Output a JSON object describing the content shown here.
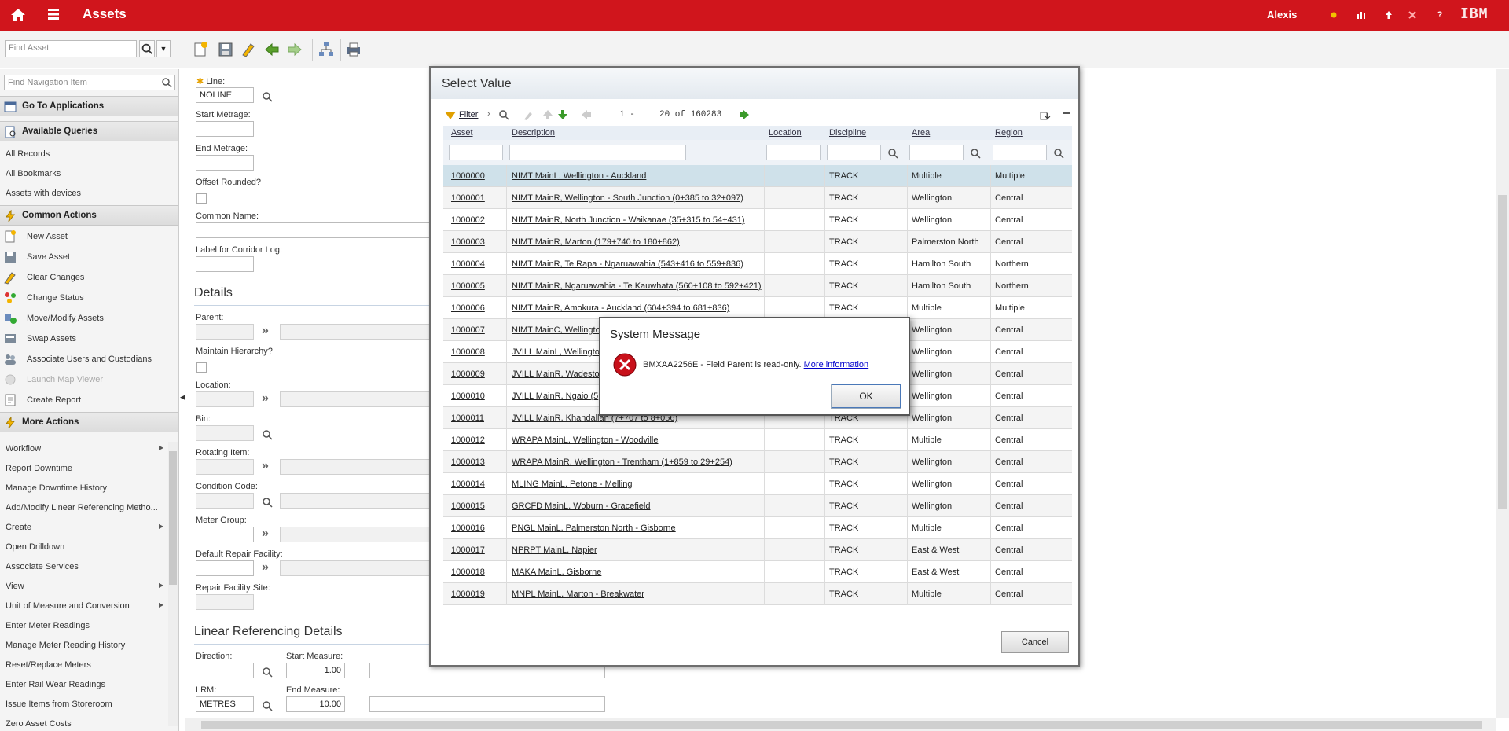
{
  "header": {
    "app_title": "Assets",
    "user": "Alexis",
    "logo": "IBM",
    "icons": [
      "home-icon",
      "menu-icon",
      "bulletin-icon",
      "reports-icon",
      "profile-icon",
      "close-icon",
      "help-icon"
    ]
  },
  "toolbar": {
    "find_placeholder": "Find Asset"
  },
  "nav": {
    "search_placeholder": "Find Navigation Item",
    "go_to_apps": "Go To Applications",
    "available_queries": "Available Queries",
    "queries": [
      "All Records",
      "All Bookmarks",
      "Assets with devices"
    ],
    "common_actions": "Common Actions",
    "actions": [
      {
        "label": "New Asset",
        "icon": "new-asset-icon"
      },
      {
        "label": "Save Asset",
        "icon": "save-icon"
      },
      {
        "label": "Clear Changes",
        "icon": "eraser-icon"
      },
      {
        "label": "Change Status",
        "icon": "change-status-icon"
      },
      {
        "label": "Move/Modify Assets",
        "icon": "move-assets-icon"
      },
      {
        "label": "Swap Assets",
        "icon": "swap-icon"
      },
      {
        "label": "Associate Users and Custodians",
        "icon": "users-icon"
      },
      {
        "label": "Launch Map Viewer",
        "icon": "map-icon",
        "disabled": true
      },
      {
        "label": "Create Report",
        "icon": "report-icon"
      }
    ],
    "more_actions": "More Actions",
    "more": [
      {
        "label": "Workflow",
        "sub": true
      },
      {
        "label": "Report Downtime",
        "sub": false
      },
      {
        "label": "Manage Downtime History",
        "sub": false
      },
      {
        "label": "Add/Modify Linear Referencing Metho...",
        "sub": false
      },
      {
        "label": "Create",
        "sub": true
      },
      {
        "label": "Open Drilldown",
        "sub": false
      },
      {
        "label": "Associate Services",
        "sub": false
      },
      {
        "label": "View",
        "sub": true
      },
      {
        "label": "Unit of Measure and Conversion",
        "sub": true
      },
      {
        "label": "Enter Meter Readings",
        "sub": false
      },
      {
        "label": "Manage Meter Reading History",
        "sub": false
      },
      {
        "label": "Reset/Replace Meters",
        "sub": false
      },
      {
        "label": "Enter Rail Wear Readings",
        "sub": false
      },
      {
        "label": "Issue Items from Storeroom",
        "sub": false
      },
      {
        "label": "Zero Asset Costs",
        "sub": false
      }
    ]
  },
  "form": {
    "line_label": "Line:",
    "line_value": "NOLINE",
    "start_metrage_label": "Start Metrage:",
    "end_metrage_label": "End Metrage:",
    "offset_rounded_label": "Offset Rounded?",
    "common_name_label": "Common Name:",
    "corridor_label": "Label for Corridor Log:",
    "details_title": "Details",
    "parent_label": "Parent:",
    "maintain_hierarchy_label": "Maintain Hierarchy?",
    "location_label": "Location:",
    "bin_label": "Bin:",
    "rotating_item_label": "Rotating Item:",
    "condition_code_label": "Condition Code:",
    "meter_group_label": "Meter Group:",
    "default_repair_label": "Default Repair Facility:",
    "repair_site_label": "Repair Facility Site:",
    "linear_title": "Linear Referencing Details",
    "direction_label": "Direction:",
    "start_measure_label": "Start Measure:",
    "start_measure_value": "1.00",
    "lrm_label": "LRM:",
    "lrm_value": "METRES",
    "end_measure_label": "End Measure:",
    "end_measure_value": "10.00"
  },
  "dialog": {
    "title": "Select Value",
    "filter_label": "Filter",
    "pager_start": "1 -",
    "pager_range": "20 of 160283",
    "columns": [
      "Asset",
      "Description",
      "Location",
      "Discipline",
      "Area",
      "Region"
    ],
    "rows": [
      {
        "asset": "1000000",
        "description": "NIMT MainL, Wellington - Auckland",
        "location": "",
        "discipline": "TRACK",
        "area": "Multiple",
        "region": "Multiple"
      },
      {
        "asset": "1000001",
        "description": "NIMT MainR, Wellington - South Junction (0+385 to 32+097)",
        "location": "",
        "discipline": "TRACK",
        "area": "Wellington",
        "region": "Central"
      },
      {
        "asset": "1000002",
        "description": "NIMT MainR, North Junction - Waikanae (35+315 to 54+431)",
        "location": "",
        "discipline": "TRACK",
        "area": "Wellington",
        "region": "Central"
      },
      {
        "asset": "1000003",
        "description": "NIMT MainR, Marton (179+740 to 180+862)",
        "location": "",
        "discipline": "TRACK",
        "area": "Palmerston North",
        "region": "Central"
      },
      {
        "asset": "1000004",
        "description": "NIMT MainR, Te Rapa - Ngaruawahia (543+416 to 559+836)",
        "location": "",
        "discipline": "TRACK",
        "area": "Hamilton South",
        "region": "Northern"
      },
      {
        "asset": "1000005",
        "description": "NIMT MainR, Ngaruawahia - Te Kauwhata (560+108 to 592+421)",
        "location": "",
        "discipline": "TRACK",
        "area": "Hamilton South",
        "region": "Northern"
      },
      {
        "asset": "1000006",
        "description": "NIMT MainR, Amokura - Auckland (604+394 to 681+836)",
        "location": "",
        "discipline": "TRACK",
        "area": "Multiple",
        "region": "Multiple"
      },
      {
        "asset": "1000007",
        "description": "NIMT MainC, Wellingto",
        "location": "",
        "discipline": "TRACK",
        "area": "Wellington",
        "region": "Central"
      },
      {
        "asset": "1000008",
        "description": "JVILL MainL, Wellingto",
        "location": "",
        "discipline": "TRACK",
        "area": "Wellington",
        "region": "Central"
      },
      {
        "asset": "1000009",
        "description": "JVILL MainR, Wadesto",
        "location": "",
        "discipline": "TRACK",
        "area": "Wellington",
        "region": "Central"
      },
      {
        "asset": "1000010",
        "description": "JVILL MainR, Ngaio (5",
        "location": "",
        "discipline": "TRACK",
        "area": "Wellington",
        "region": "Central"
      },
      {
        "asset": "1000011",
        "description": "JVILL MainR, Khandallah (7+707 to 8+056)",
        "location": "",
        "discipline": "TRACK",
        "area": "Wellington",
        "region": "Central"
      },
      {
        "asset": "1000012",
        "description": "WRAPA MainL, Wellington - Woodville",
        "location": "",
        "discipline": "TRACK",
        "area": "Multiple",
        "region": "Central"
      },
      {
        "asset": "1000013",
        "description": "WRAPA MainR, Wellington - Trentham (1+859 to 29+254)",
        "location": "",
        "discipline": "TRACK",
        "area": "Wellington",
        "region": "Central"
      },
      {
        "asset": "1000014",
        "description": "MLING MainL, Petone - Melling",
        "location": "",
        "discipline": "TRACK",
        "area": "Wellington",
        "region": "Central"
      },
      {
        "asset": "1000015",
        "description": "GRCFD MainL, Woburn - Gracefield",
        "location": "",
        "discipline": "TRACK",
        "area": "Wellington",
        "region": "Central"
      },
      {
        "asset": "1000016",
        "description": "PNGL MainL, Palmerston North - Gisborne",
        "location": "",
        "discipline": "TRACK",
        "area": "Multiple",
        "region": "Central"
      },
      {
        "asset": "1000017",
        "description": "NPRPT MainL, Napier",
        "location": "",
        "discipline": "TRACK",
        "area": "East & West",
        "region": "Central"
      },
      {
        "asset": "1000018",
        "description": "MAKA MainL, Gisborne",
        "location": "",
        "discipline": "TRACK",
        "area": "East & West",
        "region": "Central"
      },
      {
        "asset": "1000019",
        "description": "MNPL MainL, Marton - Breakwater",
        "location": "",
        "discipline": "TRACK",
        "area": "Multiple",
        "region": "Central"
      }
    ],
    "cancel_label": "Cancel"
  },
  "system_message": {
    "title": "System Message",
    "message": "BMXAA2256E - Field Parent is read-only.",
    "more_info": "More information",
    "ok_label": "OK"
  }
}
